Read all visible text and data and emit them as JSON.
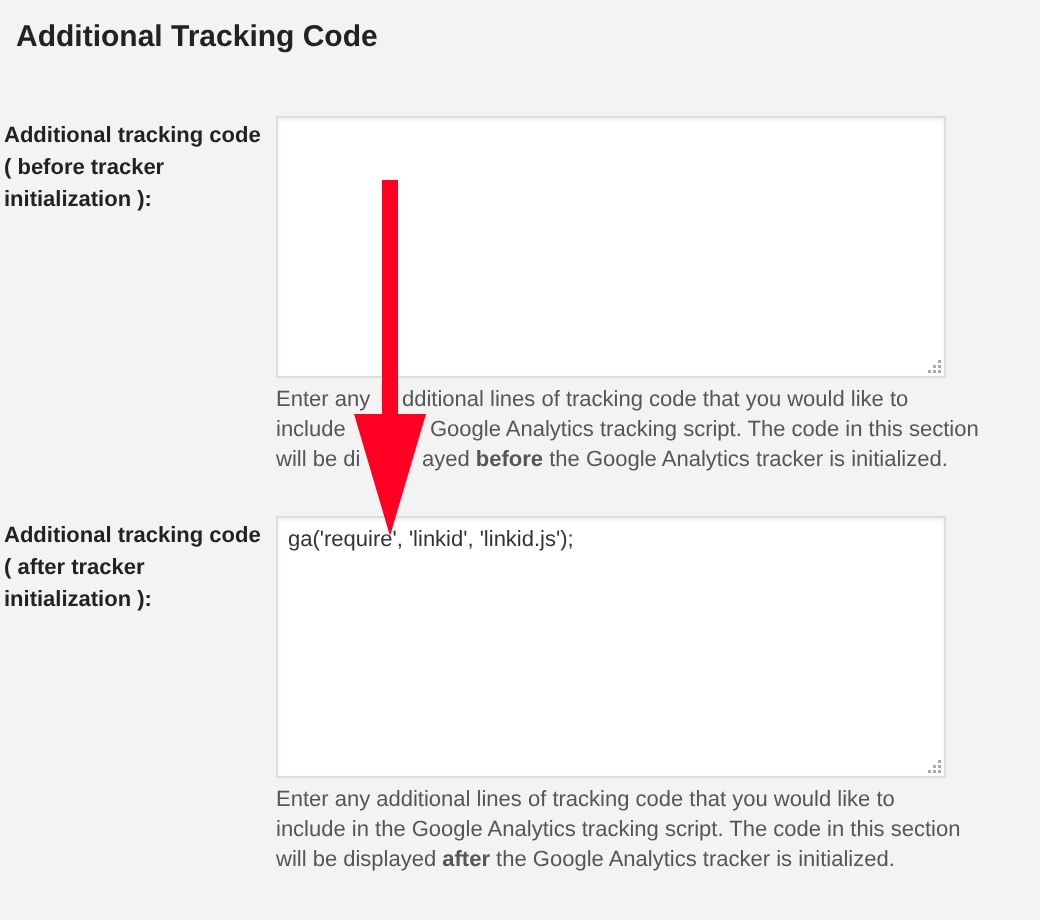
{
  "title": "Additional Tracking Code",
  "fields": [
    {
      "label": "Additional tracking code ( before tracker initialization ):",
      "description_lines": [
        {
          "left": "Enter any",
          "right": "dditional lines of tracking code that you would like to"
        },
        {
          "left": "include",
          "right": "Google Analytics tracking script. The code in this section"
        },
        {
          "left": "will be di",
          "right": "ayed **before** the Google Analytics tracker is initialized."
        }
      ]
    },
    {
      "label": "Additional tracking code ( after tracker initialization ):",
      "value": "ga('require', 'linkid', 'linkid.js');",
      "description": "Enter any additional lines of tracking code that you would like to include in the Google Analytics tracking script. The code in this section will be displayed **after** the Google Analytics tracker is initialized."
    }
  ]
}
